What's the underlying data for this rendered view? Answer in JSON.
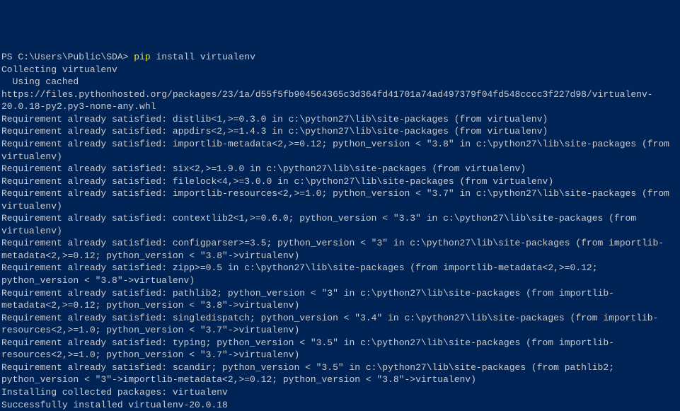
{
  "prompt": {
    "prefix": "PS C:\\Users\\Public\\SDA> ",
    "command": "pip",
    "args": " install virtualenv"
  },
  "lines": [
    "Collecting virtualenv",
    "  Using cached https://files.pythonhosted.org/packages/23/1a/d55f5fb904564365c3d364fd41701a74ad497379f04fd548cccc3f227d98/virtualenv-20.0.18-py2.py3-none-any.whl",
    "Requirement already satisfied: distlib<1,>=0.3.0 in c:\\python27\\lib\\site-packages (from virtualenv)",
    "Requirement already satisfied: appdirs<2,>=1.4.3 in c:\\python27\\lib\\site-packages (from virtualenv)",
    "Requirement already satisfied: importlib-metadata<2,>=0.12; python_version < \"3.8\" in c:\\python27\\lib\\site-packages (from virtualenv)",
    "Requirement already satisfied: six<2,>=1.9.0 in c:\\python27\\lib\\site-packages (from virtualenv)",
    "Requirement already satisfied: filelock<4,>=3.0.0 in c:\\python27\\lib\\site-packages (from virtualenv)",
    "Requirement already satisfied: importlib-resources<2,>=1.0; python_version < \"3.7\" in c:\\python27\\lib\\site-packages (from virtualenv)",
    "Requirement already satisfied: contextlib2<1,>=0.6.0; python_version < \"3.3\" in c:\\python27\\lib\\site-packages (from virtualenv)",
    "Requirement already satisfied: configparser>=3.5; python_version < \"3\" in c:\\python27\\lib\\site-packages (from importlib-metadata<2,>=0.12; python_version < \"3.8\"->virtualenv)",
    "Requirement already satisfied: zipp>=0.5 in c:\\python27\\lib\\site-packages (from importlib-metadata<2,>=0.12; python_version < \"3.8\"->virtualenv)",
    "Requirement already satisfied: pathlib2; python_version < \"3\" in c:\\python27\\lib\\site-packages (from importlib-metadata<2,>=0.12; python_version < \"3.8\"->virtualenv)",
    "Requirement already satisfied: singledispatch; python_version < \"3.4\" in c:\\python27\\lib\\site-packages (from importlib-resources<2,>=1.0; python_version < \"3.7\"->virtualenv)",
    "Requirement already satisfied: typing; python_version < \"3.5\" in c:\\python27\\lib\\site-packages (from importlib-resources<2,>=1.0; python_version < \"3.7\"->virtualenv)",
    "Requirement already satisfied: scandir; python_version < \"3.5\" in c:\\python27\\lib\\site-packages (from pathlib2; python_version < \"3\"->importlib-metadata<2,>=0.12; python_version < \"3.8\"->virtualenv)",
    "Installing collected packages: virtualenv",
    "Successfully installed virtualenv-20.0.18"
  ]
}
